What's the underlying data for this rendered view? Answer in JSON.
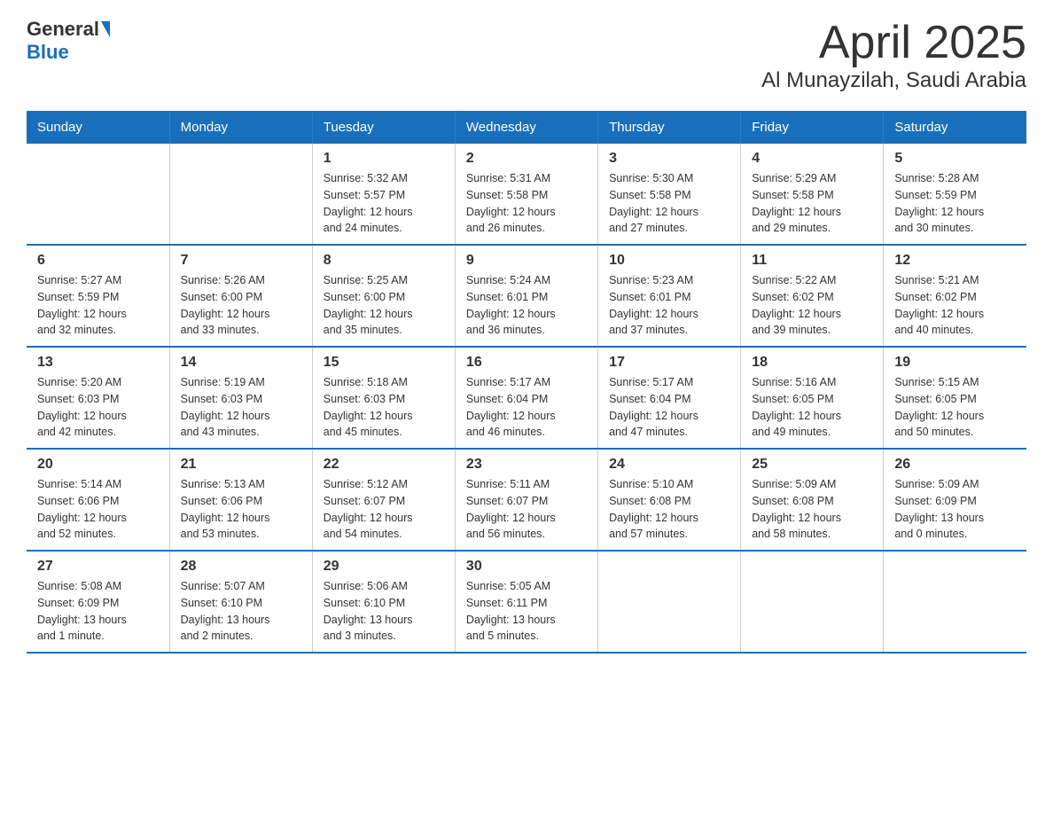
{
  "header": {
    "logo_general": "General",
    "logo_blue": "Blue",
    "title": "April 2025",
    "subtitle": "Al Munayzilah, Saudi Arabia"
  },
  "days_of_week": [
    "Sunday",
    "Monday",
    "Tuesday",
    "Wednesday",
    "Thursday",
    "Friday",
    "Saturday"
  ],
  "weeks": [
    [
      {
        "day": "",
        "info": ""
      },
      {
        "day": "",
        "info": ""
      },
      {
        "day": "1",
        "info": "Sunrise: 5:32 AM\nSunset: 5:57 PM\nDaylight: 12 hours\nand 24 minutes."
      },
      {
        "day": "2",
        "info": "Sunrise: 5:31 AM\nSunset: 5:58 PM\nDaylight: 12 hours\nand 26 minutes."
      },
      {
        "day": "3",
        "info": "Sunrise: 5:30 AM\nSunset: 5:58 PM\nDaylight: 12 hours\nand 27 minutes."
      },
      {
        "day": "4",
        "info": "Sunrise: 5:29 AM\nSunset: 5:58 PM\nDaylight: 12 hours\nand 29 minutes."
      },
      {
        "day": "5",
        "info": "Sunrise: 5:28 AM\nSunset: 5:59 PM\nDaylight: 12 hours\nand 30 minutes."
      }
    ],
    [
      {
        "day": "6",
        "info": "Sunrise: 5:27 AM\nSunset: 5:59 PM\nDaylight: 12 hours\nand 32 minutes."
      },
      {
        "day": "7",
        "info": "Sunrise: 5:26 AM\nSunset: 6:00 PM\nDaylight: 12 hours\nand 33 minutes."
      },
      {
        "day": "8",
        "info": "Sunrise: 5:25 AM\nSunset: 6:00 PM\nDaylight: 12 hours\nand 35 minutes."
      },
      {
        "day": "9",
        "info": "Sunrise: 5:24 AM\nSunset: 6:01 PM\nDaylight: 12 hours\nand 36 minutes."
      },
      {
        "day": "10",
        "info": "Sunrise: 5:23 AM\nSunset: 6:01 PM\nDaylight: 12 hours\nand 37 minutes."
      },
      {
        "day": "11",
        "info": "Sunrise: 5:22 AM\nSunset: 6:02 PM\nDaylight: 12 hours\nand 39 minutes."
      },
      {
        "day": "12",
        "info": "Sunrise: 5:21 AM\nSunset: 6:02 PM\nDaylight: 12 hours\nand 40 minutes."
      }
    ],
    [
      {
        "day": "13",
        "info": "Sunrise: 5:20 AM\nSunset: 6:03 PM\nDaylight: 12 hours\nand 42 minutes."
      },
      {
        "day": "14",
        "info": "Sunrise: 5:19 AM\nSunset: 6:03 PM\nDaylight: 12 hours\nand 43 minutes."
      },
      {
        "day": "15",
        "info": "Sunrise: 5:18 AM\nSunset: 6:03 PM\nDaylight: 12 hours\nand 45 minutes."
      },
      {
        "day": "16",
        "info": "Sunrise: 5:17 AM\nSunset: 6:04 PM\nDaylight: 12 hours\nand 46 minutes."
      },
      {
        "day": "17",
        "info": "Sunrise: 5:17 AM\nSunset: 6:04 PM\nDaylight: 12 hours\nand 47 minutes."
      },
      {
        "day": "18",
        "info": "Sunrise: 5:16 AM\nSunset: 6:05 PM\nDaylight: 12 hours\nand 49 minutes."
      },
      {
        "day": "19",
        "info": "Sunrise: 5:15 AM\nSunset: 6:05 PM\nDaylight: 12 hours\nand 50 minutes."
      }
    ],
    [
      {
        "day": "20",
        "info": "Sunrise: 5:14 AM\nSunset: 6:06 PM\nDaylight: 12 hours\nand 52 minutes."
      },
      {
        "day": "21",
        "info": "Sunrise: 5:13 AM\nSunset: 6:06 PM\nDaylight: 12 hours\nand 53 minutes."
      },
      {
        "day": "22",
        "info": "Sunrise: 5:12 AM\nSunset: 6:07 PM\nDaylight: 12 hours\nand 54 minutes."
      },
      {
        "day": "23",
        "info": "Sunrise: 5:11 AM\nSunset: 6:07 PM\nDaylight: 12 hours\nand 56 minutes."
      },
      {
        "day": "24",
        "info": "Sunrise: 5:10 AM\nSunset: 6:08 PM\nDaylight: 12 hours\nand 57 minutes."
      },
      {
        "day": "25",
        "info": "Sunrise: 5:09 AM\nSunset: 6:08 PM\nDaylight: 12 hours\nand 58 minutes."
      },
      {
        "day": "26",
        "info": "Sunrise: 5:09 AM\nSunset: 6:09 PM\nDaylight: 13 hours\nand 0 minutes."
      }
    ],
    [
      {
        "day": "27",
        "info": "Sunrise: 5:08 AM\nSunset: 6:09 PM\nDaylight: 13 hours\nand 1 minute."
      },
      {
        "day": "28",
        "info": "Sunrise: 5:07 AM\nSunset: 6:10 PM\nDaylight: 13 hours\nand 2 minutes."
      },
      {
        "day": "29",
        "info": "Sunrise: 5:06 AM\nSunset: 6:10 PM\nDaylight: 13 hours\nand 3 minutes."
      },
      {
        "day": "30",
        "info": "Sunrise: 5:05 AM\nSunset: 6:11 PM\nDaylight: 13 hours\nand 5 minutes."
      },
      {
        "day": "",
        "info": ""
      },
      {
        "day": "",
        "info": ""
      },
      {
        "day": "",
        "info": ""
      }
    ]
  ]
}
